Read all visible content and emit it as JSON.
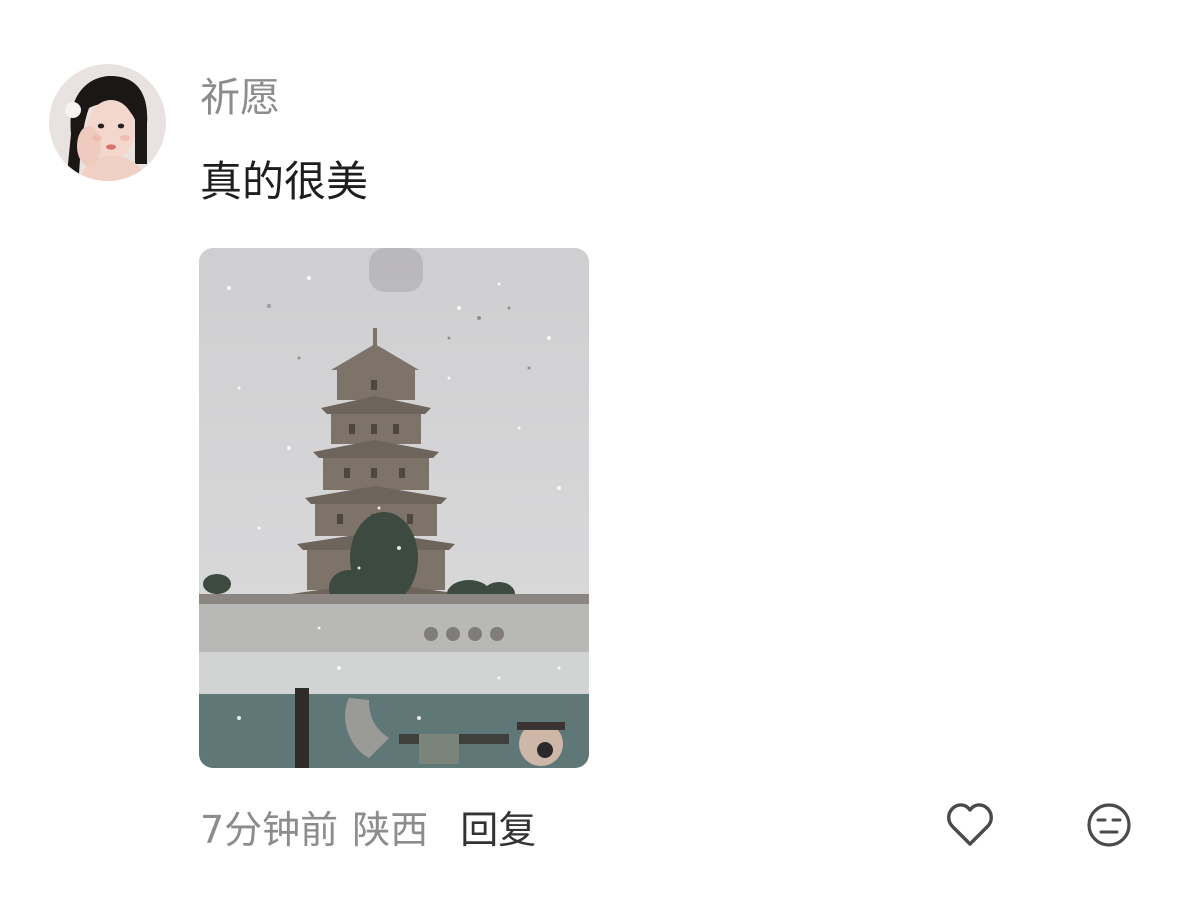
{
  "comment": {
    "username": "祈愿",
    "text": "真的很美",
    "time": "7分钟前",
    "location": "陕西",
    "reply_label": "回复"
  },
  "icons": {
    "like": "heart-outline-icon",
    "dislike": "meh-face-icon"
  },
  "colors": {
    "username": "#8c8c8c",
    "text": "#1e1e1e",
    "meta": "#8c8c8c",
    "reply": "#333333",
    "icon_stroke": "#4a4a4a"
  }
}
